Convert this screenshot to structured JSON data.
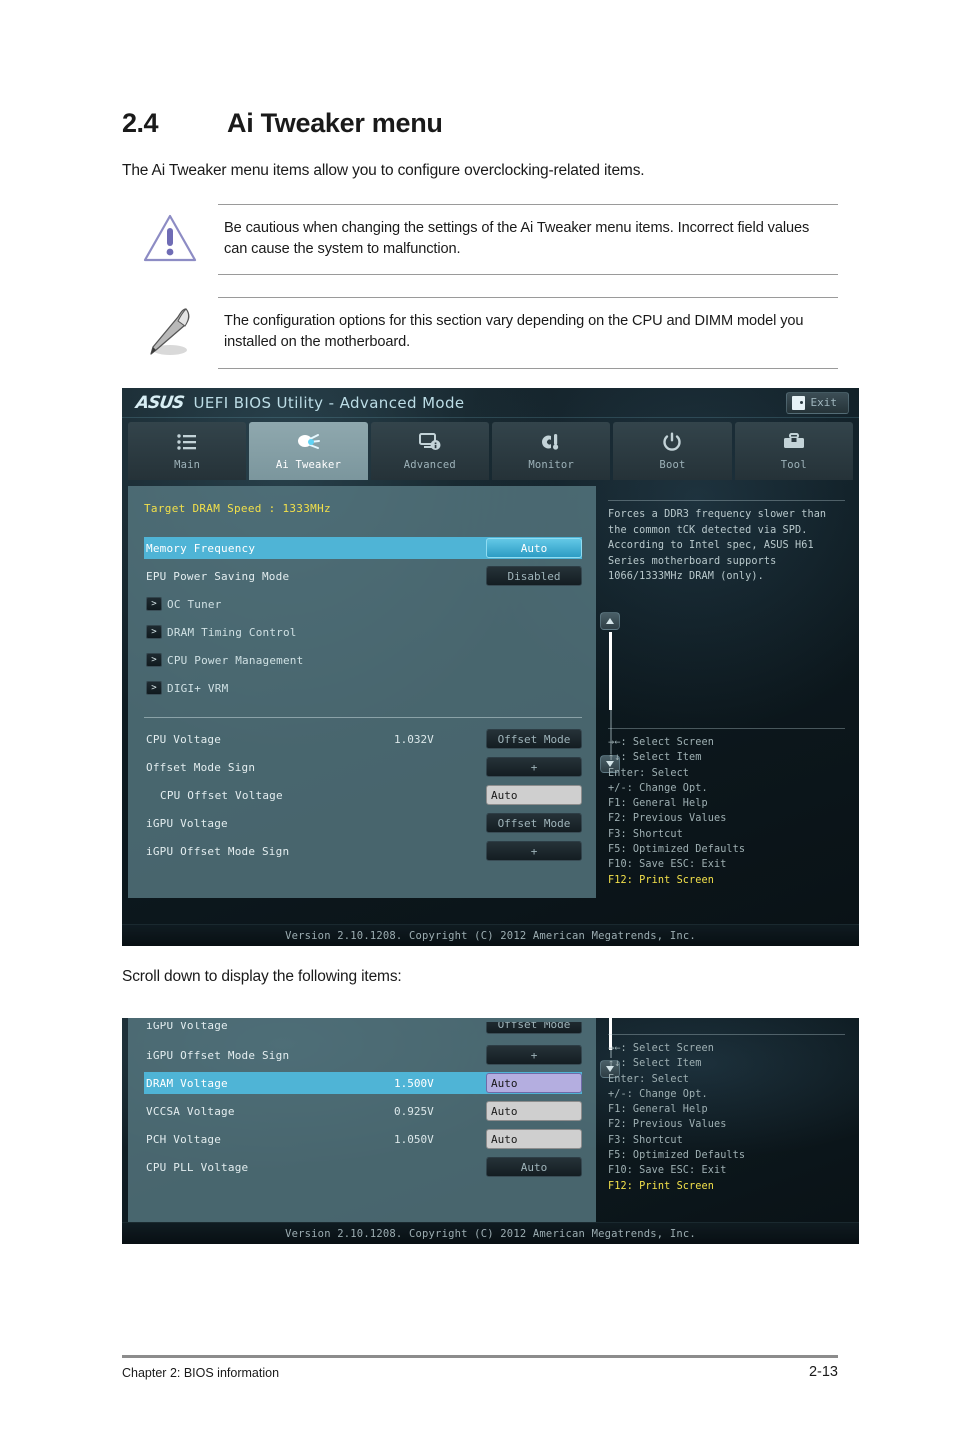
{
  "document": {
    "section_number": "2.4",
    "section_title": "Ai Tweaker menu",
    "intro": "The Ai Tweaker menu items allow you to configure overclocking-related items.",
    "warning": "Be cautious when changing the settings of the Ai Tweaker menu items. Incorrect field values can cause the system to malfunction.",
    "note": "The configuration options for this section vary depending on the CPU and DIMM model you installed on the motherboard.",
    "scroll_hint": "Scroll down to display the following items:",
    "footer_left": "Chapter 2: BIOS information",
    "footer_right": "2-13",
    "warning_icon": "warning-triangle-icon",
    "note_icon": "pencil-note-icon"
  },
  "bios": {
    "titlebar": {
      "logo": "ASUS",
      "title": "UEFI BIOS Utility - Advanced Mode",
      "exit_label": "Exit",
      "exit_icon": "exit-door-icon"
    },
    "tabs": [
      {
        "label": "Main",
        "icon": "list-icon",
        "active": false
      },
      {
        "label": "Ai Tweaker",
        "icon": "tuner-icon",
        "active": true
      },
      {
        "label": "Advanced",
        "icon": "monitor-info-icon",
        "active": false
      },
      {
        "label": "Monitor",
        "icon": "thermometer-icon",
        "active": false
      },
      {
        "label": "Boot",
        "icon": "power-icon",
        "active": false
      },
      {
        "label": "Tool",
        "icon": "toolbox-icon",
        "active": false
      }
    ],
    "target_dram_speed": "Target DRAM Speed : 1333MHz",
    "rows": [
      {
        "label": "Memory Frequency",
        "value": "",
        "control": "Auto",
        "type": "btn-selected",
        "highlight": true
      },
      {
        "label": "EPU Power Saving Mode",
        "value": "",
        "control": "Disabled",
        "type": "btn"
      },
      {
        "label": "OC Tuner",
        "value": "",
        "control": "",
        "type": "submenu"
      },
      {
        "label": "DRAM Timing Control",
        "value": "",
        "control": "",
        "type": "submenu"
      },
      {
        "label": "CPU Power Management",
        "value": "",
        "control": "",
        "type": "submenu"
      },
      {
        "label": "DIGI+ VRM",
        "value": "",
        "control": "",
        "type": "submenu"
      }
    ],
    "rows2": [
      {
        "label": "CPU Voltage",
        "value": "1.032V",
        "control": "Offset Mode",
        "type": "btn"
      },
      {
        "label": "Offset Mode Sign",
        "value": "",
        "control": "+",
        "type": "btn"
      },
      {
        "label": "CPU Offset Voltage",
        "value": "",
        "control": "Auto",
        "type": "field",
        "indent": true
      },
      {
        "label": "iGPU Voltage",
        "value": "",
        "control": "Offset Mode",
        "type": "btn"
      },
      {
        "label": "iGPU Offset Mode Sign",
        "value": "",
        "control": "+",
        "type": "btn"
      }
    ],
    "help_text": "Forces a DDR3 frequency slower than the common tCK detected via SPD. According to Intel spec, ASUS H61 Series motherboard supports 1066/1333MHz DRAM (only).",
    "legend": [
      {
        "text": "→←: Select Screen",
        "hot": false
      },
      {
        "text": "↑↓: Select Item",
        "hot": false
      },
      {
        "text": "Enter: Select",
        "hot": false
      },
      {
        "text": "+/-: Change Opt.",
        "hot": false
      },
      {
        "text": "F1: General Help",
        "hot": false
      },
      {
        "text": "F2: Previous Values",
        "hot": false
      },
      {
        "text": "F3: Shortcut",
        "hot": false
      },
      {
        "text": "F5: Optimized Defaults",
        "hot": false
      },
      {
        "text": "F10: Save  ESC: Exit",
        "hot": false
      },
      {
        "text": "F12: Print Screen",
        "hot": true
      }
    ],
    "footer": "Version 2.10.1208. Copyright (C) 2012 American Megatrends, Inc."
  },
  "bios2": {
    "rows": [
      {
        "label": "iGPU Voltage",
        "value": "",
        "control": "Offset Mode",
        "type": "btn",
        "clipped": true
      },
      {
        "label": "iGPU Offset Mode Sign",
        "value": "",
        "control": "+",
        "type": "btn"
      },
      {
        "label": "DRAM Voltage",
        "value": "1.500V",
        "control": "Auto",
        "type": "field-active",
        "highlight": true
      },
      {
        "label": "VCCSA Voltage",
        "value": "0.925V",
        "control": "Auto",
        "type": "field"
      },
      {
        "label": "PCH Voltage",
        "value": "1.050V",
        "control": "Auto",
        "type": "field"
      },
      {
        "label": "CPU PLL Voltage",
        "value": "",
        "control": "Auto",
        "type": "btn"
      }
    ],
    "legend": [
      {
        "text": "→←: Select Screen",
        "hot": false
      },
      {
        "text": "↑↓: Select Item",
        "hot": false
      },
      {
        "text": "Enter: Select",
        "hot": false
      },
      {
        "text": "+/-: Change Opt.",
        "hot": false
      },
      {
        "text": "F1: General Help",
        "hot": false
      },
      {
        "text": "F2: Previous Values",
        "hot": false
      },
      {
        "text": "F3: Shortcut",
        "hot": false
      },
      {
        "text": "F5: Optimized Defaults",
        "hot": false
      },
      {
        "text": "F10: Save  ESC: Exit",
        "hot": false
      },
      {
        "text": "F12: Print Screen",
        "hot": true
      }
    ],
    "footer": "Version 2.10.1208. Copyright (C) 2012 American Megatrends, Inc."
  },
  "colors": {
    "highlight": "#4fb4d6",
    "accent_yellow": "#f2e04a",
    "panel": "#587982",
    "field_active": "#b4aee0"
  }
}
